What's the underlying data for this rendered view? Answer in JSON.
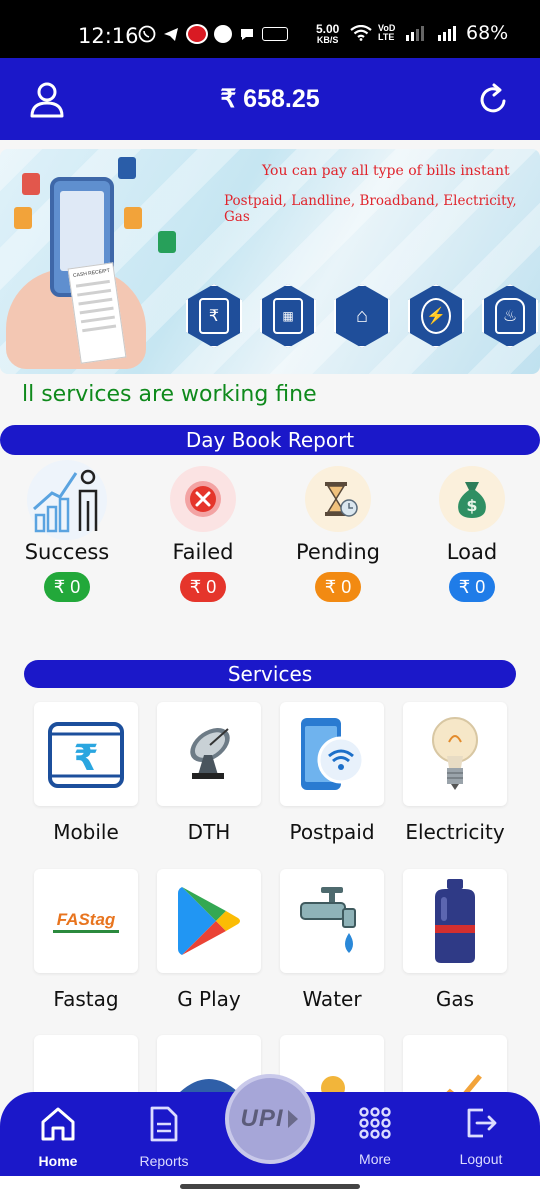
{
  "status_bar": {
    "time": "12:16",
    "speed_value": "5.00",
    "speed_unit": "KB/S",
    "volte": "VoD LTE",
    "battery": "68%",
    "app_icons": [
      "whatsapp-icon",
      "telegram-icon",
      "jio-icon",
      "phone-icon",
      "chat-icon",
      "rs-icon"
    ]
  },
  "header": {
    "balance": "₹ 658.25",
    "user_icon": "user-icon",
    "refresh_icon": "refresh-icon",
    "color": "#1b18c9"
  },
  "banner": {
    "line1": "You can pay all type of bills instant",
    "line2": "Postpaid, Landline, Broadband, Electricity, Gas",
    "receipt_title": "CASH RECEIPT",
    "hex_icons": [
      "mobile-rupee-icon",
      "landline-icon",
      "router-icon",
      "electricity-icon",
      "gas-cylinder-icon"
    ]
  },
  "marquee": {
    "text": "ll services are working fine"
  },
  "day_book": {
    "title": "Day Book Report",
    "items": [
      {
        "label": "Success",
        "value": "₹ 0",
        "color": "#22a83a",
        "icon": "growth-chart-icon"
      },
      {
        "label": "Failed",
        "value": "₹ 0",
        "color": "#e5352b",
        "icon": "failed-x-icon"
      },
      {
        "label": "Pending",
        "value": "₹ 0",
        "color": "#f28a12",
        "icon": "hourglass-icon"
      },
      {
        "label": "Load",
        "value": "₹ 0",
        "color": "#1f7ce8",
        "icon": "money-bag-icon"
      }
    ]
  },
  "services": {
    "title": "Services",
    "items": [
      {
        "label": "Mobile",
        "icon": "mobile-recharge-icon"
      },
      {
        "label": "DTH",
        "icon": "satellite-dish-icon"
      },
      {
        "label": "Postpaid",
        "icon": "postpaid-wifi-icon"
      },
      {
        "label": "Electricity",
        "icon": "light-bulb-icon"
      },
      {
        "label": "Fastag",
        "icon": "fastag-icon"
      },
      {
        "label": "G Play",
        "icon": "google-play-icon"
      },
      {
        "label": "Water",
        "icon": "water-tap-icon"
      },
      {
        "label": "Gas",
        "icon": "gas-cylinder-icon"
      }
    ],
    "fastag_logo": "FAStag"
  },
  "bottom_nav": {
    "items": [
      {
        "label": "Home",
        "icon": "home-icon",
        "active": true
      },
      {
        "label": "Reports",
        "icon": "reports-icon",
        "active": false
      },
      {
        "label": "More",
        "icon": "grid-dots-icon",
        "active": false
      },
      {
        "label": "Logout",
        "icon": "logout-icon",
        "active": false
      }
    ],
    "upi_label": "UPI"
  }
}
